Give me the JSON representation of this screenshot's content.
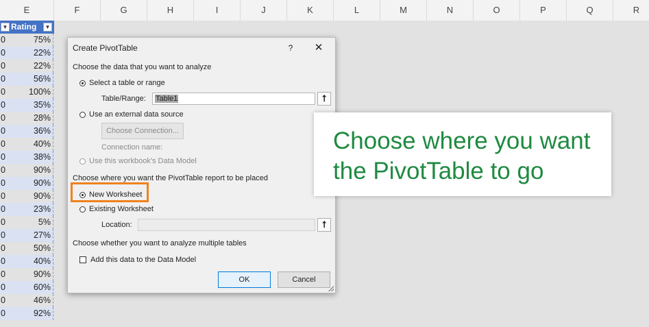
{
  "sheet": {
    "columns": [
      "E",
      "F",
      "G",
      "H",
      "I",
      "J",
      "K",
      "L",
      "M",
      "N",
      "O",
      "P",
      "Q",
      "R"
    ],
    "table": {
      "header_label": "Rating",
      "first_col_values": [
        "0",
        "0",
        "0",
        "0",
        "0",
        "0",
        "0",
        "0",
        "0",
        "0",
        "0",
        "0",
        "0",
        "0",
        "0",
        "0",
        "0",
        "0",
        "0",
        "0",
        "0",
        "0"
      ],
      "ratings": [
        "75%",
        "22%",
        "22%",
        "56%",
        "100%",
        "35%",
        "28%",
        "36%",
        "40%",
        "38%",
        "90%",
        "90%",
        "90%",
        "23%",
        "5%",
        "27%",
        "50%",
        "40%",
        "90%",
        "60%",
        "46%",
        "92%"
      ]
    }
  },
  "dialog": {
    "title": "Create PivotTable",
    "help": "?",
    "close": "✕",
    "section1": "Choose the data that you want to analyze",
    "opt_select_table": "Select a table or range",
    "table_range_label": "Table/Range:",
    "table_range_value": "Table1",
    "opt_external": "Use an external data source",
    "choose_connection": "Choose Connection...",
    "connection_name_label": "Connection name:",
    "opt_data_model": "Use this workbook's Data Model",
    "section2": "Choose where you want the PivotTable report to be placed",
    "opt_new_ws": "New Worksheet",
    "opt_existing_ws": "Existing Worksheet",
    "location_label": "Location:",
    "location_value": "",
    "section3": "Choose whether you want to analyze multiple tables",
    "add_data_model": "Add this data to the Data Model",
    "ok": "OK",
    "cancel": "Cancel",
    "collapse_icon": "⭡"
  },
  "callout": {
    "line1": "Choose where you want",
    "line2": "the PivotTable to go"
  },
  "colors": {
    "table_header": "#4472c4",
    "band": "#d9e1f2",
    "highlight": "#f0811e",
    "callout_text": "#1e8a40"
  }
}
